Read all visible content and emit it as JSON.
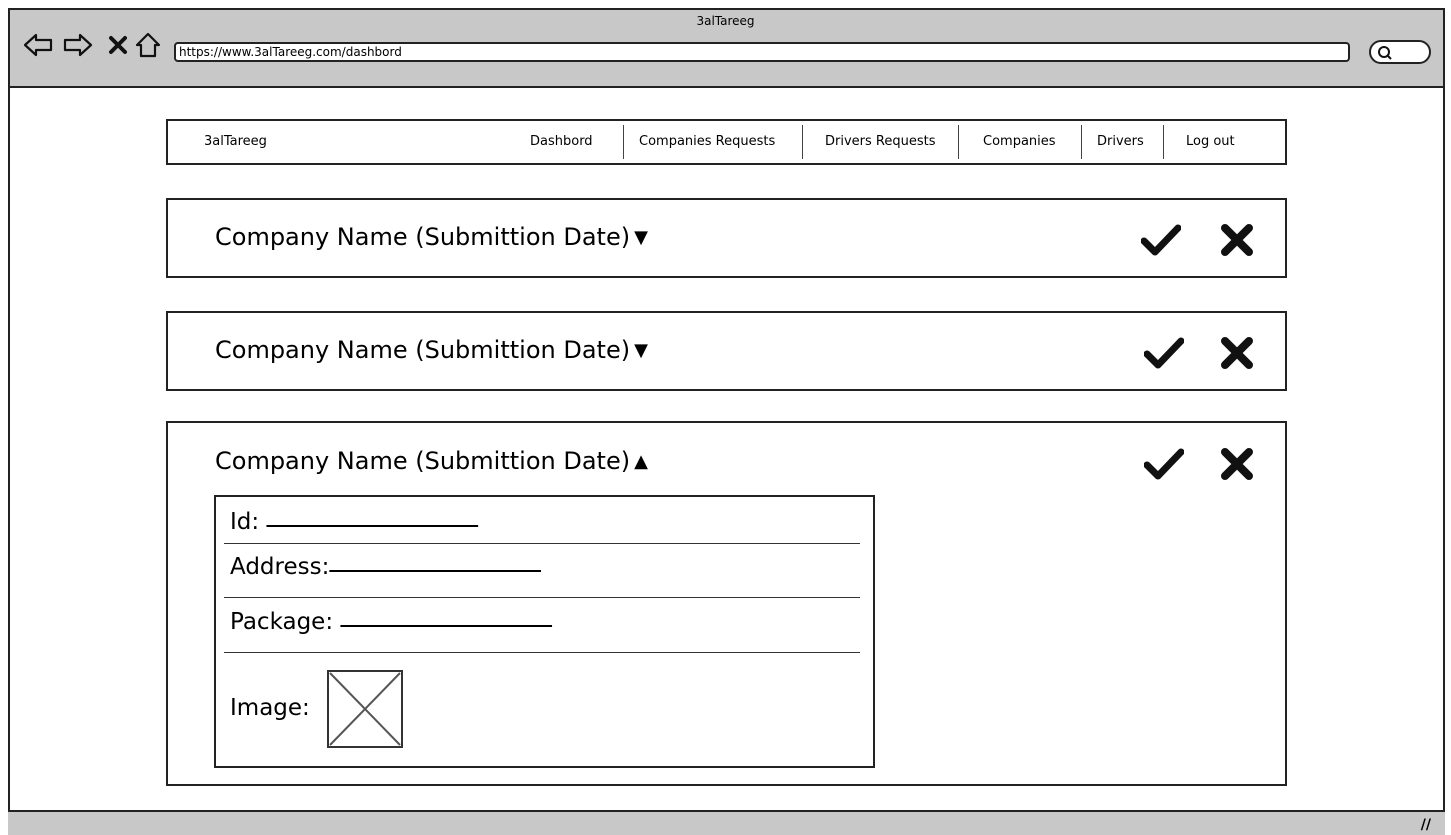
{
  "browser": {
    "title": "3alTareeg",
    "url": "https://www.3alTareeg.com/dashbord"
  },
  "nav": {
    "brand": "3alTareeg",
    "items": [
      {
        "label": "Dashbord"
      },
      {
        "label": "Companies Requests"
      },
      {
        "label": "Drivers Requests"
      },
      {
        "label": "Companies"
      },
      {
        "label": "Drivers"
      },
      {
        "label": "Log out"
      }
    ]
  },
  "requests": [
    {
      "title": "Company Name (Submittion Date)",
      "expanded": false,
      "caret": "▼"
    },
    {
      "title": "Company Name (Submittion Date)",
      "expanded": false,
      "caret": "▼"
    },
    {
      "title": "Company Name (Submittion Date)",
      "expanded": true,
      "caret": "▲"
    }
  ],
  "details": {
    "id_label": "Id:",
    "id_value": "~~~~ ~~~~ ~~~~ ~~~ ~~~~ ~~~~~~~~",
    "address_label": "Address:",
    "address_value": "~~~~ ~~~~ ~~~~ ~~~ ~~~~ ~~~~~~~~",
    "package_label": "Package:",
    "package_value": "~~~~ ~~~~ ~~~~ ~~~ ~~~~ ~~~~~~~~",
    "image_label": "Image:"
  },
  "icons": {
    "approve": "check-icon",
    "reject": "close-icon",
    "back": "arrow-left-icon",
    "forward": "arrow-right-icon",
    "stop": "stop-icon",
    "home": "home-icon",
    "search": "search-icon"
  }
}
